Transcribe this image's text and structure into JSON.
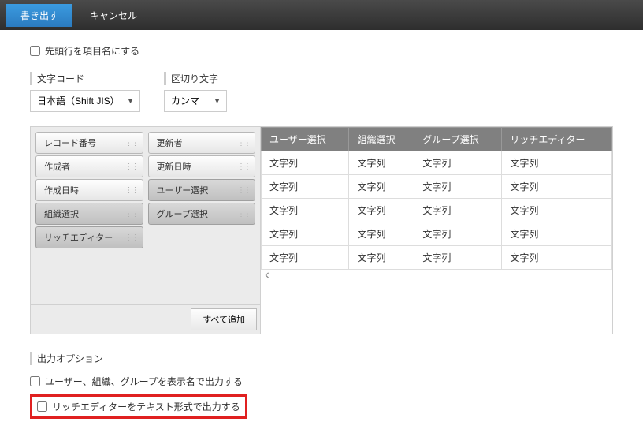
{
  "toolbar": {
    "export": "書き出す",
    "cancel": "キャンセル"
  },
  "header_row": {
    "label": "先頭行を項目名にする"
  },
  "encoding": {
    "label": "文字コード",
    "value": "日本語（Shift JIS）"
  },
  "delimiter": {
    "label": "区切り文字",
    "value": "カンマ"
  },
  "pool": {
    "col1": [
      {
        "label": "レコード番号",
        "selected": false
      },
      {
        "label": "作成者",
        "selected": false
      },
      {
        "label": "作成日時",
        "selected": false
      },
      {
        "label": "組織選択",
        "selected": true
      },
      {
        "label": "リッチエディター",
        "selected": true
      }
    ],
    "col2": [
      {
        "label": "更新者",
        "selected": false
      },
      {
        "label": "更新日時",
        "selected": false
      },
      {
        "label": "ユーザー選択",
        "selected": true
      },
      {
        "label": "グループ選択",
        "selected": true
      }
    ],
    "add_all": "すべて追加"
  },
  "table": {
    "headers": [
      "ユーザー選択",
      "組織選択",
      "グループ選択",
      "リッチエディター"
    ],
    "rows": [
      [
        "文字列",
        "文字列",
        "文字列",
        "文字列"
      ],
      [
        "文字列",
        "文字列",
        "文字列",
        "文字列"
      ],
      [
        "文字列",
        "文字列",
        "文字列",
        "文字列"
      ],
      [
        "文字列",
        "文字列",
        "文字列",
        "文字列"
      ],
      [
        "文字列",
        "文字列",
        "文字列",
        "文字列"
      ]
    ]
  },
  "output_options": {
    "label": "出力オプション",
    "opt1": "ユーザー、組織、グループを表示名で出力する",
    "opt2": "リッチエディターをテキスト形式で出力する"
  }
}
